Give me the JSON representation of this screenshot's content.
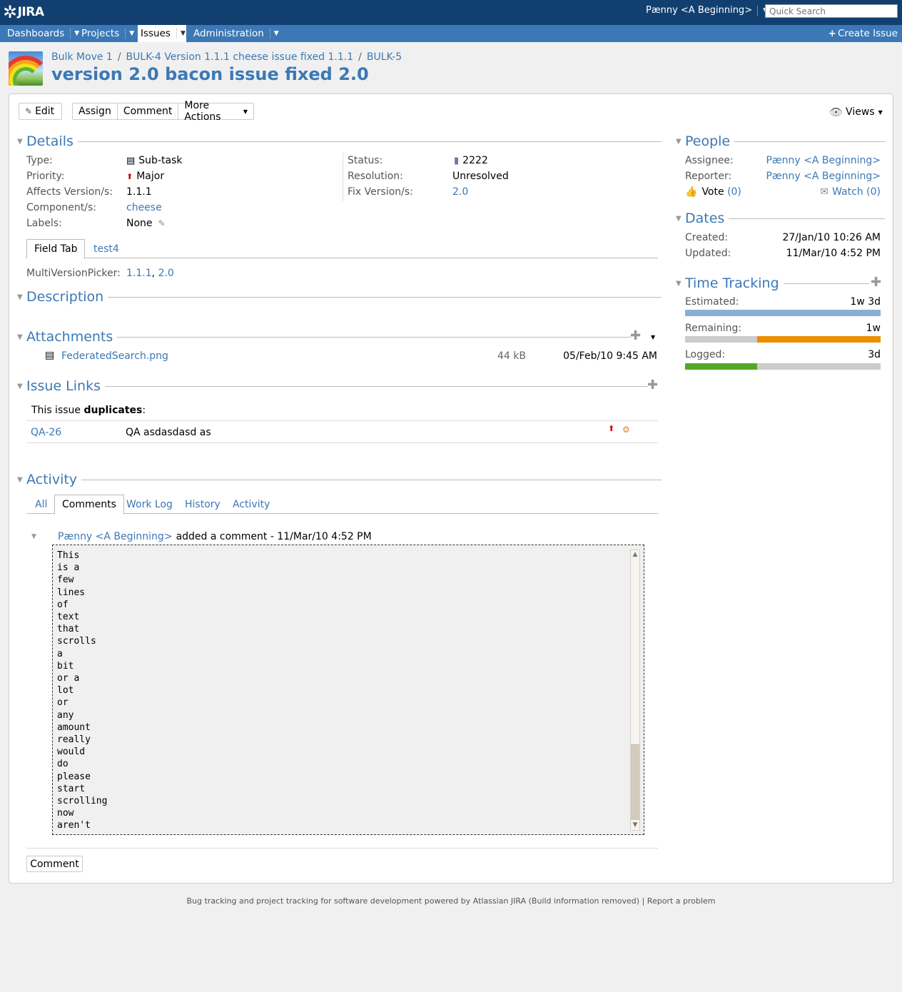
{
  "header": {
    "logo_text": "JIRA",
    "user": "Pænny <A Beginning>",
    "search_placeholder": "Quick Search"
  },
  "nav": {
    "items": [
      {
        "label": "Dashboards"
      },
      {
        "label": "Projects"
      },
      {
        "label": "Issues"
      },
      {
        "label": "Administration"
      }
    ],
    "create_issue": "Create Issue"
  },
  "breadcrumb": {
    "items": [
      {
        "label": "Bulk Move 1"
      },
      {
        "label": "BULK-4 Version 1.1.1 cheese issue fixed 1.1.1"
      },
      {
        "label": "BULK-5"
      }
    ],
    "separator": "/"
  },
  "issue": {
    "title": "version 2.0 bacon issue fixed 2.0"
  },
  "toolbar": {
    "edit": "Edit",
    "assign": "Assign",
    "comment": "Comment",
    "more_actions": "More Actions",
    "views": "Views"
  },
  "details": {
    "heading": "Details",
    "type_label": "Type:",
    "type_value": "Sub-task",
    "priority_label": "Priority:",
    "priority_value": "Major",
    "affects_label": "Affects Version/s:",
    "affects_value": "1.1.1",
    "component_label": "Component/s:",
    "component_value": "cheese",
    "labels_label": "Labels:",
    "labels_value": "None",
    "status_label": "Status:",
    "status_value": "2222",
    "resolution_label": "Resolution:",
    "resolution_value": "Unresolved",
    "fix_label": "Fix Version/s:",
    "fix_value": "2.0",
    "tabs": [
      {
        "label": "Field Tab"
      },
      {
        "label": "test4"
      }
    ],
    "mvp_label": "MultiVersionPicker:",
    "mvp_values": [
      "1.1.1",
      "2.0"
    ],
    "mvp_separator": ","
  },
  "description": {
    "heading": "Description"
  },
  "attachments": {
    "heading": "Attachments",
    "items": [
      {
        "name": "FederatedSearch.png",
        "size": "44 kB",
        "date": "05/Feb/10 9:45 AM"
      }
    ]
  },
  "issue_links": {
    "heading": "Issue Links",
    "intro": "This issue",
    "relation": "duplicates",
    "colon": ":",
    "links": [
      {
        "key": "QA-26",
        "summary": "QA asdasdasd as"
      }
    ]
  },
  "activity": {
    "heading": "Activity",
    "tabs": [
      {
        "label": "All"
      },
      {
        "label": "Comments"
      },
      {
        "label": "Work Log"
      },
      {
        "label": "History"
      },
      {
        "label": "Activity"
      }
    ],
    "comment": {
      "author": "Pænny <A Beginning>",
      "meta": "added a comment - 11/Mar/10 4:52 PM",
      "body": "This\nis a\nfew\nlines\nof\ntext\nthat\nscrolls\na\nbit\nor a\nlot\nor\nany\namount\nreally\nwould\ndo\nplease\nstart\nscrolling\nnow\naren't"
    },
    "comment_button": "Comment"
  },
  "people": {
    "heading": "People",
    "assignee_label": "Assignee:",
    "assignee_value": "Pænny <A Beginning>",
    "reporter_label": "Reporter:",
    "reporter_value": "Pænny <A Beginning>",
    "vote_label": "Vote",
    "vote_count": "(0)",
    "watch_label": "Watch",
    "watch_count": "(0)"
  },
  "dates": {
    "heading": "Dates",
    "created_label": "Created:",
    "created_value": "27/Jan/10 10:26 AM",
    "updated_label": "Updated:",
    "updated_value": "11/Mar/10 4:52 PM"
  },
  "time_tracking": {
    "heading": "Time Tracking",
    "estimated_label": "Estimated:",
    "estimated_value": "1w 3d",
    "remaining_label": "Remaining:",
    "remaining_value": "1w",
    "logged_label": "Logged:",
    "logged_value": "3d",
    "estimated_fraction": 1.0,
    "remaining_fraction": 0.63,
    "logged_fraction": 0.37,
    "colors": {
      "estimated": "#89afd7",
      "remaining": "#ec8e00",
      "logged": "#51a825",
      "empty": "#cccccc"
    }
  },
  "footer": {
    "text": "Bug tracking and project tracking for software development powered by Atlassian JIRA (Build information removed)",
    "separator": "|",
    "report": "Report a problem"
  }
}
